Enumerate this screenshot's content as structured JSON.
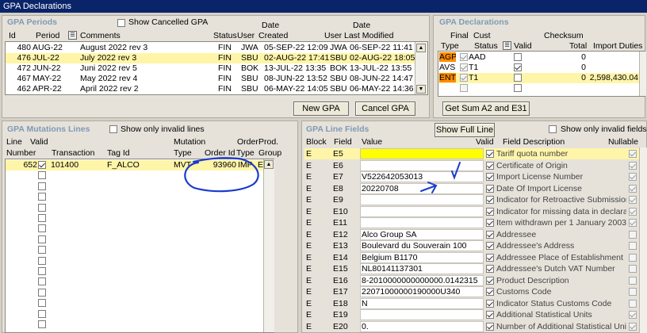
{
  "window_title": "GPA Declarations",
  "periods": {
    "title": "GPA Periods",
    "show_cancelled_label": "Show Cancelled GPA",
    "show_cancelled_checked": false,
    "col_date1": "Date",
    "col_date2": "Date",
    "columns": [
      "Id",
      "Period",
      "Comments",
      "Status",
      "User",
      "Created",
      "User",
      "Last Modified"
    ],
    "rows": [
      {
        "id": "480",
        "period": "AUG-22",
        "comment": "August 2022 rev 3",
        "status": "FIN",
        "user": "JWA",
        "created": "05-SEP-22 12:09",
        "muser": "JWA",
        "modified": "06-SEP-22 11:41"
      },
      {
        "id": "476",
        "period": "JUL-22",
        "comment": "July 2022 rev 3",
        "status": "FIN",
        "user": "SBU",
        "created": "02-AUG-22 17:41",
        "muser": "SBU",
        "modified": "02-AUG-22 18:05"
      },
      {
        "id": "472",
        "period": "JUN-22",
        "comment": "Juni 2022 rev 5",
        "status": "FIN",
        "user": "BOK",
        "created": "13-JUL-22 13:35",
        "muser": "BOK",
        "modified": "13-JUL-22 13:55"
      },
      {
        "id": "467",
        "period": "MAY-22",
        "comment": "May 2022 rev 4",
        "status": "FIN",
        "user": "SBU",
        "created": "08-JUN-22 13:52",
        "muser": "SBU",
        "modified": "08-JUN-22 14:47"
      },
      {
        "id": "462",
        "period": "APR-22",
        "comment": "April 2022 rev 2",
        "status": "FIN",
        "user": "SBU",
        "created": "06-MAY-22 14:05",
        "muser": "SBU",
        "modified": "06-MAY-22 14:36"
      }
    ],
    "new_button": "New GPA",
    "cancel_button": "Cancel GPA"
  },
  "declarations": {
    "title": "GPA Declarations",
    "col_final": "Final",
    "col_cust": "Cust",
    "col_checksum": "Checksum",
    "columns": [
      "Type",
      "Status",
      "Valid",
      "Total",
      "Import Duties"
    ],
    "rows": [
      {
        "type": "AGP",
        "status": "AAD",
        "valid": false,
        "total": "0",
        "duties": ""
      },
      {
        "type": "AVS",
        "status": "T1",
        "valid": true,
        "total": "0",
        "duties": ""
      },
      {
        "type": "ENT",
        "status": "T1",
        "valid": false,
        "total": "0",
        "duties": "2,598,430.04"
      }
    ],
    "sum_button": "Get Sum A2 and E31"
  },
  "mutations": {
    "title": "GPA Mutations Lines",
    "show_invalid_label": "Show only invalid lines",
    "col_mutation": "Mutation",
    "col_order": "Order",
    "col_prod": "Prod.",
    "columns": [
      "Line Number",
      "Valid",
      "Transaction",
      "Tag Id",
      "Type",
      "Order Id",
      "Type",
      "Group"
    ],
    "col_line": "Line",
    "col_number": "Number",
    "col_valid": "Valid",
    "row": {
      "line": "652",
      "transaction": "101400",
      "tag": "F_ALCO",
      "mtype": "MVT",
      "order_id": "93960",
      "otype": "IMP",
      "group": "ETH"
    }
  },
  "fields": {
    "title": "GPA Line Fields",
    "show_full_line": "Show Full Line",
    "show_invalid_label": "Show only invalid fields",
    "columns": [
      "Block",
      "Field",
      "Value",
      "Valid",
      "Field Description",
      "Nullable"
    ],
    "rows": [
      {
        "block": "E",
        "field": "E5",
        "value": "",
        "desc": "Tariff quota number",
        "valid": true,
        "nullable": true
      },
      {
        "block": "E",
        "field": "E6",
        "value": "",
        "desc": "Certificate of Origin",
        "valid": true,
        "nullable": true
      },
      {
        "block": "E",
        "field": "E7",
        "value": "V522642053013",
        "desc": "Import License Number",
        "valid": true,
        "nullable": true
      },
      {
        "block": "E",
        "field": "E8",
        "value": "20220708",
        "desc": "Date Of Import License",
        "valid": true,
        "nullable": true
      },
      {
        "block": "E",
        "field": "E9",
        "value": "",
        "desc": "Indicator for Retroactive Submission",
        "valid": true,
        "nullable": true
      },
      {
        "block": "E",
        "field": "E10",
        "value": "",
        "desc": "Indicator for missing data in declara",
        "valid": true,
        "nullable": true
      },
      {
        "block": "E",
        "field": "E11",
        "value": "",
        "desc": "Item withdrawn per 1 January 2003",
        "valid": true,
        "nullable": true
      },
      {
        "block": "E",
        "field": "E12",
        "value": "Alco Group SA",
        "desc": "Addressee",
        "valid": true,
        "nullable": false
      },
      {
        "block": "E",
        "field": "E13",
        "value": "Boulevard du Souverain 100",
        "desc": "Addressee's Address",
        "valid": true,
        "nullable": false
      },
      {
        "block": "E",
        "field": "E14",
        "value": "Belgium B1170",
        "desc": "Addressee Place of Establishment",
        "valid": true,
        "nullable": false
      },
      {
        "block": "E",
        "field": "E15",
        "value": "NL80141137301",
        "desc": "Addressee's Dutch VAT Number",
        "valid": true,
        "nullable": false
      },
      {
        "block": "E",
        "field": "E16",
        "value": "8-2010000000000000.0142315",
        "desc": "Product Description",
        "valid": true,
        "nullable": false
      },
      {
        "block": "E",
        "field": "E17",
        "value": "22071000000190000U340",
        "desc": "Customs Code",
        "valid": true,
        "nullable": false
      },
      {
        "block": "E",
        "field": "E18",
        "value": "N",
        "desc": "Indicator Status Customs Code",
        "valid": true,
        "nullable": false
      },
      {
        "block": "E",
        "field": "E19",
        "value": "",
        "desc": "Additional Statistical Units",
        "valid": true,
        "nullable": true
      },
      {
        "block": "E",
        "field": "E20",
        "value": "0.",
        "desc": "Number of Additional Statistical Unit",
        "valid": true,
        "nullable": true
      }
    ]
  },
  "colors": {
    "selected_row": "#fff5a8",
    "highlight_value": "#ffff00",
    "orange_type": "#ff8c00",
    "ink": "#1a3bcc",
    "title_bar": "#0a246a"
  }
}
